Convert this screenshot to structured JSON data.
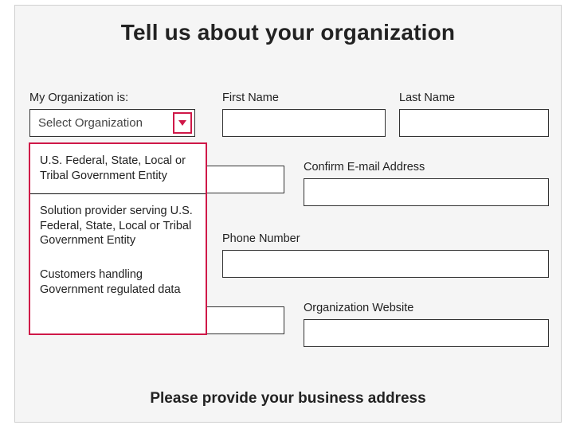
{
  "title": "Tell us about your organization",
  "fields": {
    "org_label": "My Organization is:",
    "org_placeholder": "Select Organization",
    "first_name_label": "First Name",
    "last_name_label": "Last Name",
    "email_label": "",
    "confirm_email_label": "Confirm E-mail Address",
    "phone_label": "Phone Number",
    "org_name_label": "",
    "website_label": "Organization Website"
  },
  "dropdown": {
    "options": [
      "U.S. Federal, State, Local or Tribal Government Entity",
      "Solution provider serving U.S. Federal, State, Local or Tribal Government Entity",
      "Customers handling Government regulated data"
    ]
  },
  "section_title": "Please provide your business address"
}
